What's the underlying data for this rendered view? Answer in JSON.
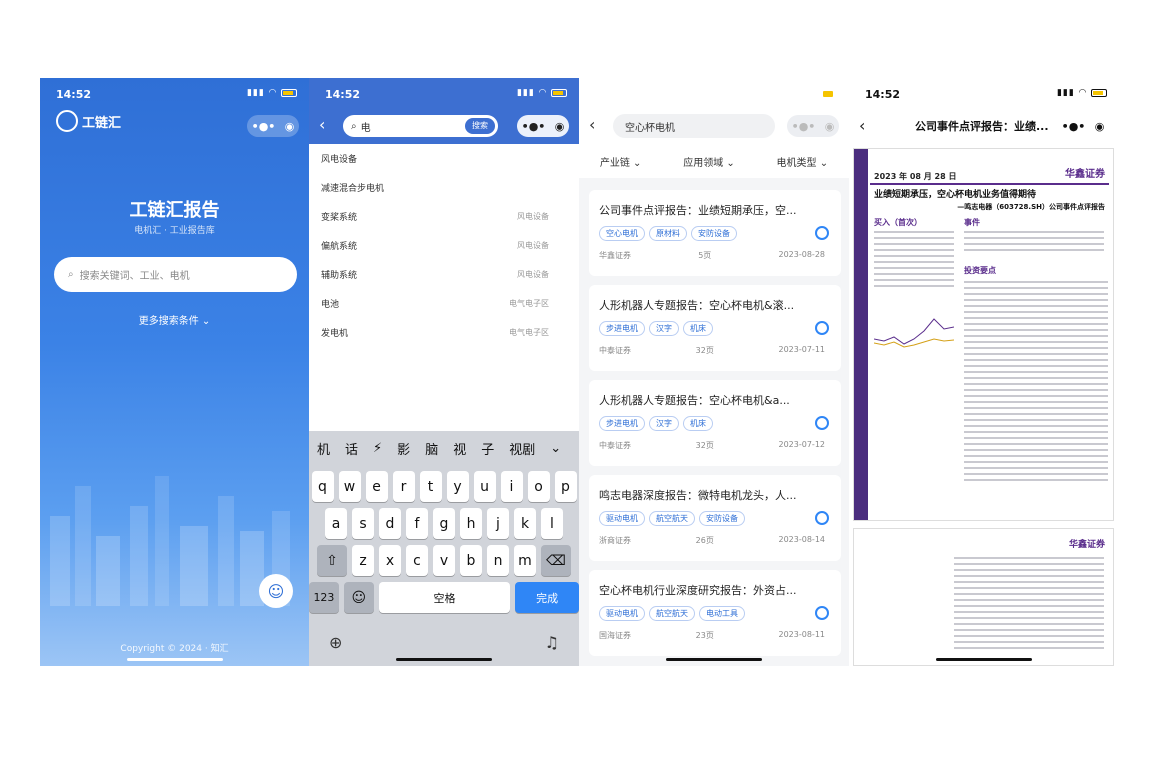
{
  "p1": {
    "status_time": "14:52",
    "logo_text": "工链汇",
    "title": "工链汇报告",
    "subtitle": "电机汇 · 工业报告库",
    "search_placeholder": "搜索关键词、工业、电机",
    "more": "更多搜索条件 ⌄",
    "copyright": "Copyright © 2024 · 知汇"
  },
  "p2": {
    "status_time": "14:52",
    "search_value": "电",
    "search_btn": "搜索",
    "suggestions": [
      {
        "label": "风电设备",
        "cat": ""
      },
      {
        "label": "减速混合步电机",
        "cat": ""
      },
      {
        "label": "变桨系统",
        "cat": "风电设备"
      },
      {
        "label": "偏航系统",
        "cat": "风电设备"
      },
      {
        "label": "辅助系统",
        "cat": "风电设备"
      },
      {
        "label": "电池",
        "cat": "电气电子区"
      },
      {
        "label": "发电机",
        "cat": "电气电子区"
      }
    ],
    "candidates": [
      "机",
      "话",
      "⚡",
      "影",
      "脑",
      "视",
      "子",
      "视剧",
      "⌄"
    ],
    "row1": [
      "q",
      "w",
      "e",
      "r",
      "t",
      "y",
      "u",
      "i",
      "o",
      "p"
    ],
    "row2": [
      "a",
      "s",
      "d",
      "f",
      "g",
      "h",
      "j",
      "k",
      "l"
    ],
    "row3": [
      "z",
      "x",
      "c",
      "v",
      "b",
      "n",
      "m"
    ],
    "key_123": "123",
    "key_space": "空格",
    "key_done": "完成"
  },
  "p3": {
    "search_value": "空心杯电机",
    "filters": [
      "产业链 ⌄",
      "应用领域 ⌄",
      "电机类型 ⌄"
    ],
    "cards": [
      {
        "title": "公司事件点评报告：业绩短期承压，空...",
        "tags": [
          "空心电机",
          "原材料",
          "安防设备"
        ],
        "source": "华鑫证券",
        "pages": "5页",
        "date": "2023-08-28"
      },
      {
        "title": "人形机器人专题报告：空心杯电机&滚...",
        "tags": [
          "步进电机",
          "汉字",
          "机床"
        ],
        "source": "中泰证券",
        "pages": "32页",
        "date": "2023-07-11"
      },
      {
        "title": "人形机器人专题报告：空心杯电机&a...",
        "tags": [
          "步进电机",
          "汉字",
          "机床"
        ],
        "source": "中泰证券",
        "pages": "32页",
        "date": "2023-07-12"
      },
      {
        "title": "鸣志电器深度报告：微特电机龙头，人...",
        "tags": [
          "驱动电机",
          "航空航天",
          "安防设备"
        ],
        "source": "浙商证券",
        "pages": "26页",
        "date": "2023-08-14"
      },
      {
        "title": "空心杯电机行业深度研究报告：外资占...",
        "tags": [
          "驱动电机",
          "航空航天",
          "电动工具"
        ],
        "source": "国海证券",
        "pages": "23页",
        "date": "2023-08-11"
      }
    ]
  },
  "p4": {
    "status_time": "14:52",
    "nav_title": "公司事件点评报告：业绩...",
    "date": "2023 年 08 月 28 日",
    "brand": "华鑫证券",
    "doc_title": "业绩短期承压，空心杯电机业务值得期待",
    "doc_sub": "—鸣志电器（603728.SH）公司事件点评报告",
    "rating": "买入（首次）",
    "event": "事件",
    "points": "投资要点",
    "brand2": "华鑫证券"
  },
  "colors": {
    "primary": "#3d6fd1",
    "accent": "#2f86f6",
    "brand_purple": "#5a2d8c"
  }
}
